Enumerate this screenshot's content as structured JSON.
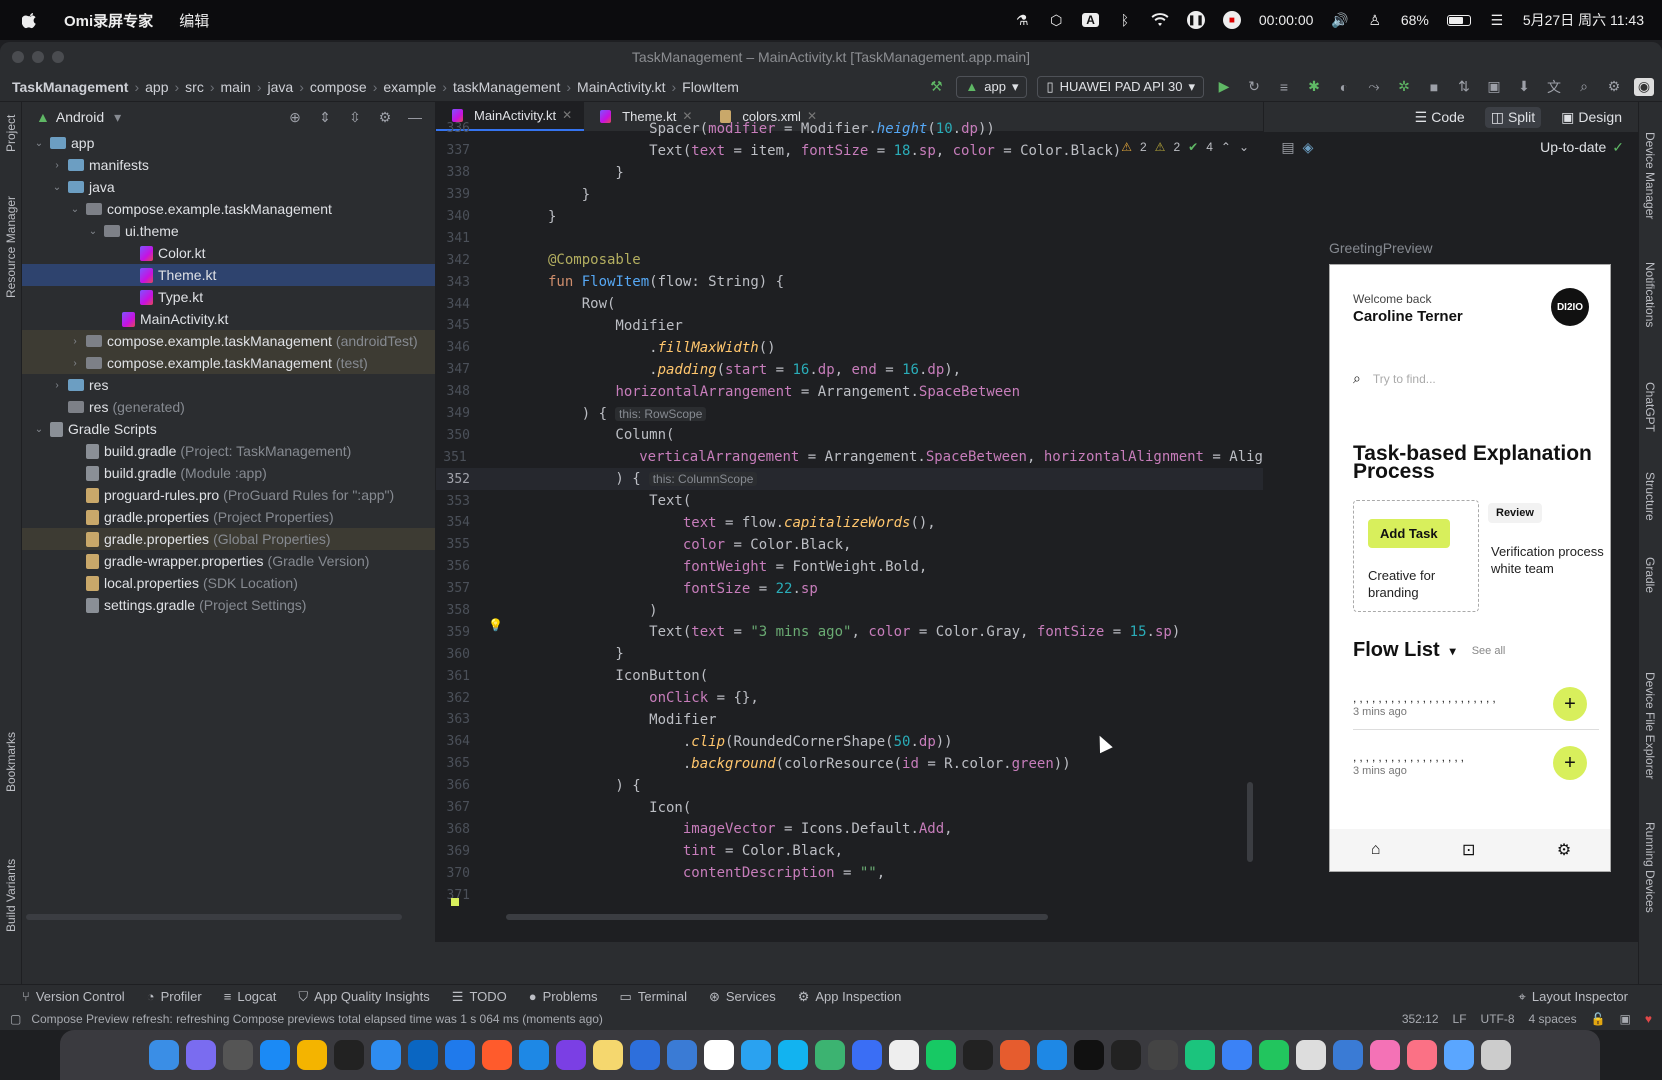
{
  "menubar": {
    "app_name": "Omi录屏专家",
    "menu_edit": "编辑",
    "input_method": "A",
    "rec_time": "00:00:00",
    "battery": "68%",
    "datetime": "5月27日 周六 11:43"
  },
  "window": {
    "title": "TaskManagement – MainActivity.kt [TaskManagement.app.main]"
  },
  "breadcrumb": [
    "TaskManagement",
    "app",
    "src",
    "main",
    "java",
    "compose",
    "example",
    "taskManagement",
    "MainActivity.kt",
    "FlowItem"
  ],
  "toolbar": {
    "run_config": "app",
    "device": "HUAWEI PAD API 30"
  },
  "left_stripe": {
    "project": "Project",
    "resource_manager": "Resource Manager",
    "bookmarks": "Bookmarks",
    "build_variants": "Build Variants"
  },
  "right_stripe": {
    "device_manager": "Device Manager",
    "notifications": "Notifications",
    "chatgpt": "ChatGPT",
    "structure": "Structure",
    "gradle": "Gradle",
    "device_file_explorer": "Device File Explorer",
    "running_devices": "Running Devices"
  },
  "project_panel": {
    "view_mode": "Android",
    "tree": [
      {
        "label": "app",
        "hint": "",
        "indent": 0,
        "chev": "⌄",
        "icon": "folder",
        "state": ""
      },
      {
        "label": "manifests",
        "hint": "",
        "indent": 1,
        "chev": "›",
        "icon": "folder",
        "state": ""
      },
      {
        "label": "java",
        "hint": "",
        "indent": 1,
        "chev": "⌄",
        "icon": "folder",
        "state": ""
      },
      {
        "label": "compose.example.taskManagement",
        "hint": "",
        "indent": 2,
        "chev": "⌄",
        "icon": "folder-gray",
        "state": ""
      },
      {
        "label": "ui.theme",
        "hint": "",
        "indent": 3,
        "chev": "⌄",
        "icon": "folder-gray",
        "state": ""
      },
      {
        "label": "Color.kt",
        "hint": "",
        "indent": 5,
        "chev": "",
        "icon": "kt",
        "state": ""
      },
      {
        "label": "Theme.kt",
        "hint": "",
        "indent": 5,
        "chev": "",
        "icon": "kt",
        "state": "selected"
      },
      {
        "label": "Type.kt",
        "hint": "",
        "indent": 5,
        "chev": "",
        "icon": "kt",
        "state": ""
      },
      {
        "label": "MainActivity.kt",
        "hint": "",
        "indent": 4,
        "chev": "",
        "icon": "kt",
        "state": ""
      },
      {
        "label": "compose.example.taskManagement",
        "hint": "(androidTest)",
        "indent": 2,
        "chev": "›",
        "icon": "folder-gray",
        "state": "muted"
      },
      {
        "label": "compose.example.taskManagement",
        "hint": "(test)",
        "indent": 2,
        "chev": "›",
        "icon": "folder-gray",
        "state": "muted"
      },
      {
        "label": "res",
        "hint": "",
        "indent": 1,
        "chev": "›",
        "icon": "folder",
        "state": ""
      },
      {
        "label": "res",
        "hint": "(generated)",
        "indent": 1,
        "chev": "",
        "icon": "folder-gray",
        "state": ""
      },
      {
        "label": "Gradle Scripts",
        "hint": "",
        "indent": 0,
        "chev": "⌄",
        "icon": "gradle",
        "state": ""
      },
      {
        "label": "build.gradle",
        "hint": "(Project: TaskManagement)",
        "indent": 2,
        "chev": "",
        "icon": "gradle",
        "state": ""
      },
      {
        "label": "build.gradle",
        "hint": "(Module :app)",
        "indent": 2,
        "chev": "",
        "icon": "gradle",
        "state": ""
      },
      {
        "label": "proguard-rules.pro",
        "hint": "(ProGuard Rules for \":app\")",
        "indent": 2,
        "chev": "",
        "icon": "prop",
        "state": ""
      },
      {
        "label": "gradle.properties",
        "hint": "(Project Properties)",
        "indent": 2,
        "chev": "",
        "icon": "prop",
        "state": ""
      },
      {
        "label": "gradle.properties",
        "hint": "(Global Properties)",
        "indent": 2,
        "chev": "",
        "icon": "prop",
        "state": "highlight"
      },
      {
        "label": "gradle-wrapper.properties",
        "hint": "(Gradle Version)",
        "indent": 2,
        "chev": "",
        "icon": "prop",
        "state": ""
      },
      {
        "label": "local.properties",
        "hint": "(SDK Location)",
        "indent": 2,
        "chev": "",
        "icon": "prop",
        "state": ""
      },
      {
        "label": "settings.gradle",
        "hint": "(Project Settings)",
        "indent": 2,
        "chev": "",
        "icon": "gradle",
        "state": ""
      }
    ]
  },
  "editor": {
    "tabs": [
      {
        "label": "MainActivity.kt",
        "active": true
      },
      {
        "label": "Theme.kt",
        "active": false
      },
      {
        "label": "colors.xml",
        "active": false
      }
    ],
    "inspections": {
      "warnings": "2",
      "weak_warnings": "2",
      "ok": "4"
    },
    "lines": [
      {
        "n": "336",
        "html": "            <span class='ct'>Spacer(</span><span class='p'>modifier</span> = Modifier.<span class='it'>height</span>(<span class='n'>10</span>.<span class='p'>dp</span>))"
      },
      {
        "n": "337",
        "html": "            Text(<span class='p'>text</span> = item, <span class='p'>fontSize</span> = <span class='n'>18</span>.<span class='p'>sp</span>, <span class='p'>color</span> = Color.Black)"
      },
      {
        "n": "338",
        "html": "        }"
      },
      {
        "n": "339",
        "html": "    }"
      },
      {
        "n": "340",
        "html": "}"
      },
      {
        "n": "341",
        "html": ""
      },
      {
        "n": "342",
        "html": "<span class='a'>@Composable</span>"
      },
      {
        "n": "343",
        "html": "<span class='k'>fun</span> <span class='f'>FlowItem</span>(flow: String) {"
      },
      {
        "n": "344",
        "html": "    Row("
      },
      {
        "n": "345",
        "html": "        Modifier"
      },
      {
        "n": "346",
        "html": "            .<span class='fi'>fillMaxWidth</span>()"
      },
      {
        "n": "347",
        "html": "            .<span class='fi'>padding</span>(<span class='p'>start</span> = <span class='n'>16</span>.<span class='p'>dp</span>, <span class='p'>end</span> = <span class='n'>16</span>.<span class='p'>dp</span>),"
      },
      {
        "n": "348",
        "html": "        <span class='p'>horizontalArrangement</span> = Arrangement.<span class='p'>SpaceBetween</span>"
      },
      {
        "n": "349",
        "html": "    ) {<span class='inl'>this: RowScope</span>"
      },
      {
        "n": "350",
        "html": "        Column("
      },
      {
        "n": "351",
        "html": "            <span class='p'>verticalArrangement</span> = Arrangement.<span class='p'>SpaceBetween</span>, <span class='p'>horizontalAlignment</span> = Alig"
      },
      {
        "n": "352",
        "html": "        ) {<span class='inl'>this: ColumnScope</span>"
      },
      {
        "n": "353",
        "html": "            Text("
      },
      {
        "n": "354",
        "html": "                <span class='p'>text</span> = flow.<span class='fi'>capitalizeWords</span>(),"
      },
      {
        "n": "355",
        "html": "                <span class='p'>color</span> = Color.Black,"
      },
      {
        "n": "356",
        "html": "                <span class='p'>fontWeight</span> = FontWeight.Bold,"
      },
      {
        "n": "357",
        "html": "                <span class='p'>fontSize</span> = <span class='n'>22</span>.<span class='p'>sp</span>"
      },
      {
        "n": "358",
        "html": "            )"
      },
      {
        "n": "359",
        "html": "            Text(<span class='p'>text</span> = <span class='s'>\"3 mins ago\"</span>, <span class='p'>color</span> = Color.Gray, <span class='p'>fontSize</span> = <span class='n'>15</span>.<span class='p'>sp</span>)"
      },
      {
        "n": "360",
        "html": "        }"
      },
      {
        "n": "361",
        "html": "        IconButton("
      },
      {
        "n": "362",
        "html": "            <span class='p'>onClick</span> = {},"
      },
      {
        "n": "363",
        "html": "            Modifier"
      },
      {
        "n": "364",
        "html": "                .<span class='fi'>clip</span>(RoundedCornerShape(<span class='n'>50</span>.<span class='p'>dp</span>))"
      },
      {
        "n": "365",
        "html": "                .<span class='fi'>background</span>(colorResource(<span class='p'>id</span> = R.color.<span class='p'>green</span>))"
      },
      {
        "n": "366",
        "html": "        ) {"
      },
      {
        "n": "367",
        "html": "            Icon("
      },
      {
        "n": "368",
        "html": "                <span class='p'>imageVector</span> = Icons.Default.<span class='p'>Add</span>,"
      },
      {
        "n": "369",
        "html": "                <span class='p'>tint</span> = Color.Black,"
      },
      {
        "n": "370",
        "html": "                <span class='p'>contentDescription</span> = <span class='s'>\"\"</span>,"
      },
      {
        "n": "371",
        "html": ""
      }
    ]
  },
  "design": {
    "code": "Code",
    "split": "Split",
    "design": "Design",
    "up_to_date": "Up-to-date",
    "preview_name": "GreetingPreview"
  },
  "phone": {
    "welcome": "Welcome back",
    "name": "Caroline Terner",
    "avatar": "DI2IO",
    "search_placeholder": "Try to find...",
    "title": "Task-based Explanation Process",
    "add_task": "Add Task",
    "card_text": "Creative for branding",
    "review": "Review",
    "verification": "Verification process white team",
    "flow_list": "Flow List",
    "see_all": "See all",
    "items": [
      {
        "dots": ",,,,,,,,,,,,,,,,,,,,,,,",
        "ago": "3 mins ago"
      },
      {
        "dots": ",,,,,,,,,,,,,,,,,,",
        "ago": "3 mins ago"
      }
    ]
  },
  "bottom_tools": [
    "Version Control",
    "Profiler",
    "Logcat",
    "App Quality Insights",
    "TODO",
    "Problems",
    "Terminal",
    "Services",
    "App Inspection"
  ],
  "layout_inspector": "Layout Inspector",
  "status": {
    "message": "Compose Preview refresh: refreshing Compose previews total elapsed time was 1 s 064 ms (moments ago)",
    "position": "352:12",
    "line_sep": "LF",
    "encoding": "UTF-8",
    "indent": "4 spaces"
  },
  "dock_colors": [
    "#3a8ee6",
    "#7a6cf0",
    "#555",
    "#1b8af5",
    "#f4b400",
    "#222",
    "#2e8cf0",
    "#0a66c2",
    "#1f7aec",
    "#ff5b2c",
    "#1e88e5",
    "#7b3fe4",
    "#f5d76e",
    "#2d6fdc",
    "#3a7bd5",
    "#fff",
    "#2aa2f0",
    "#12b3f0",
    "#3cb371",
    "#3a6ef5",
    "#eee",
    "#17c964",
    "#222",
    "#e65c2e",
    "#1e88e5",
    "#111",
    "#222",
    "#444",
    "#1bc47d",
    "#3b82f6",
    "#22c55e",
    "#ddd",
    "#3a7bd5",
    "#f472b6",
    "#fb7185",
    "#5aa6ff",
    "#ccc"
  ]
}
